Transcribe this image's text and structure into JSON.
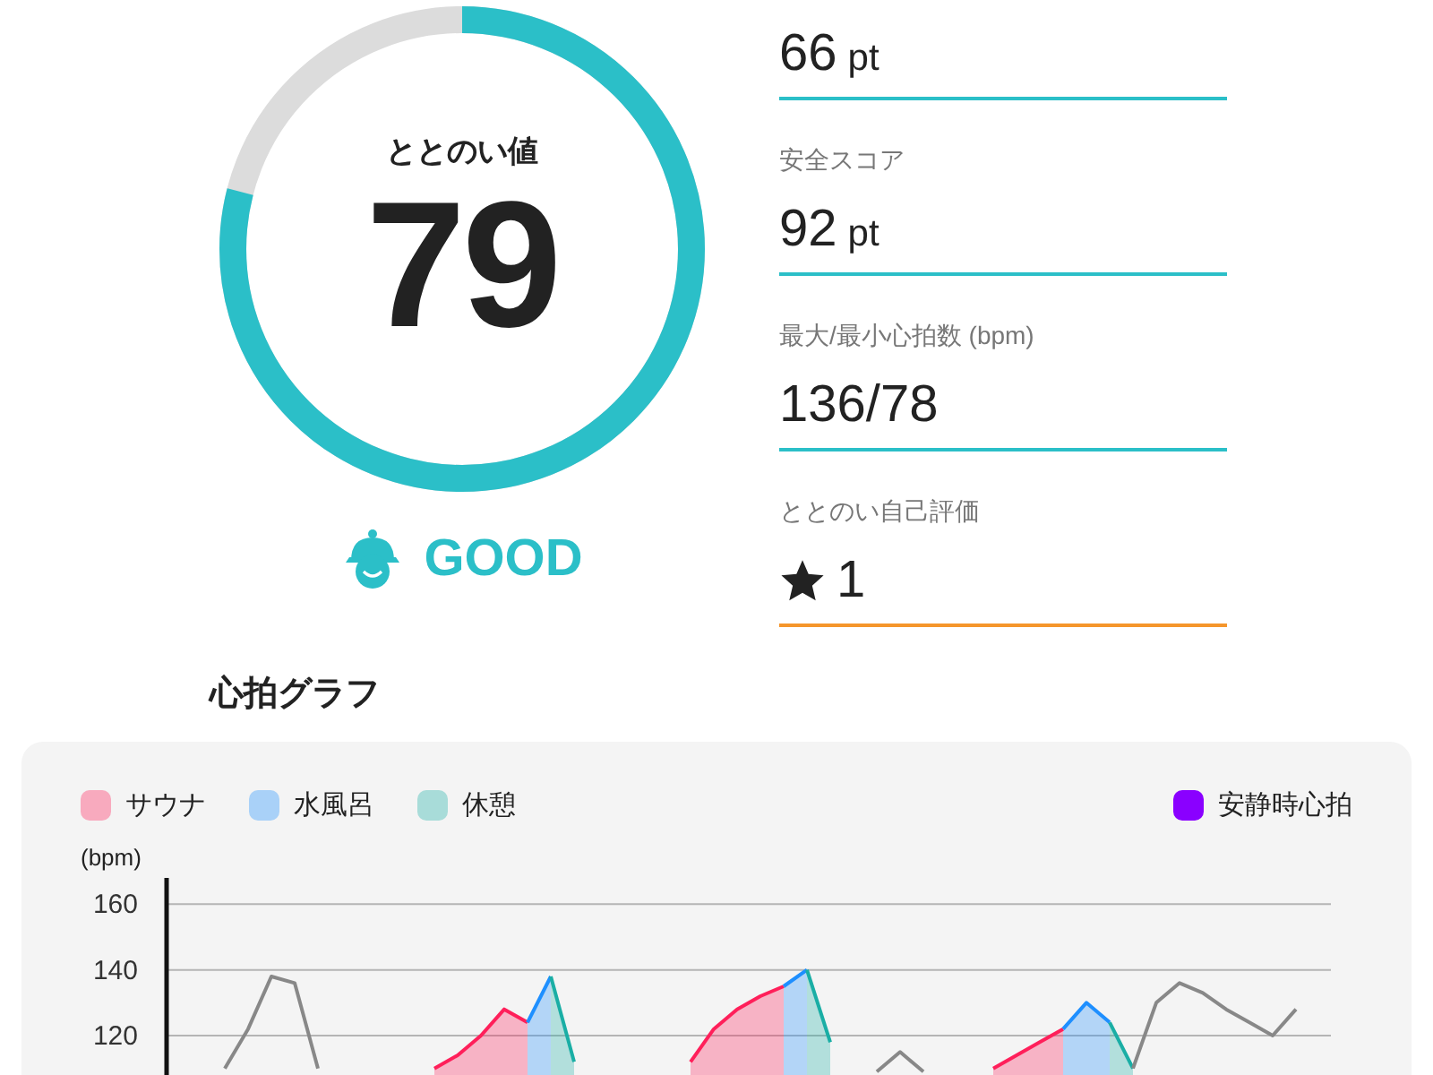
{
  "score": {
    "title": "ととのい値",
    "value": "79",
    "level": 0.79,
    "grade": "GOOD"
  },
  "stats": [
    {
      "kind": "score",
      "value": "66",
      "unit": "pt"
    },
    {
      "kind": "score",
      "label": "安全スコア",
      "value": "92",
      "unit": "pt"
    },
    {
      "kind": "score",
      "label": "最大/最小心拍数 (bpm)",
      "value": "136/78"
    },
    {
      "kind": "rating",
      "label": "ととのい自己評価",
      "value": "1"
    }
  ],
  "heart_chart": {
    "title": "心拍グラフ",
    "legend_extra": [
      {
        "label": "安静時心拍",
        "color": "#8a00ff"
      }
    ],
    "chart_data": {
      "type": "area",
      "ylabel": "(bpm)",
      "yticks": [
        120,
        140,
        160
      ],
      "ylim": [
        108,
        168
      ],
      "grid": true,
      "series": [
        {
          "name": "サウナ",
          "color": "#ff1f5a",
          "values": [
            null,
            null,
            null,
            null,
            null,
            null,
            null,
            null,
            null,
            null,
            null,
            110,
            114,
            120,
            128,
            124,
            null,
            null,
            null,
            null,
            null,
            null,
            112,
            122,
            128,
            132,
            135,
            null,
            null,
            null,
            null,
            null,
            null,
            null,
            null,
            110,
            114,
            118,
            122,
            null,
            null,
            null,
            null,
            null,
            null,
            null,
            null,
            null,
            null,
            null
          ]
        },
        {
          "name": "水風呂",
          "color": "#1e8fff",
          "values": [
            null,
            null,
            null,
            null,
            null,
            null,
            null,
            null,
            null,
            null,
            null,
            null,
            null,
            null,
            null,
            124,
            138,
            null,
            null,
            null,
            null,
            null,
            null,
            null,
            null,
            null,
            135,
            140,
            null,
            null,
            null,
            null,
            null,
            null,
            null,
            null,
            null,
            null,
            122,
            130,
            124,
            null,
            null,
            null,
            null,
            null,
            null,
            null,
            null,
            null
          ]
        },
        {
          "name": "休憩",
          "color": "#1aaea5",
          "values": [
            null,
            null,
            null,
            null,
            null,
            null,
            null,
            null,
            null,
            null,
            null,
            null,
            null,
            null,
            null,
            null,
            138,
            112,
            null,
            null,
            null,
            null,
            null,
            null,
            null,
            null,
            null,
            140,
            118,
            null,
            null,
            null,
            null,
            null,
            null,
            null,
            null,
            null,
            null,
            null,
            124,
            110,
            null,
            null,
            null,
            null,
            null,
            null,
            null,
            null
          ]
        },
        {
          "color": "#888888",
          "type": "line",
          "values": [
            null,
            null,
            110,
            122,
            138,
            136,
            110,
            null,
            null,
            null,
            null,
            null,
            null,
            null,
            null,
            null,
            null,
            null,
            null,
            null,
            null,
            null,
            null,
            null,
            null,
            null,
            null,
            null,
            null,
            null,
            109,
            115,
            109,
            null,
            null,
            null,
            null,
            null,
            null,
            null,
            null,
            110,
            130,
            136,
            133,
            128,
            124,
            120,
            128,
            null
          ]
        }
      ]
    }
  }
}
